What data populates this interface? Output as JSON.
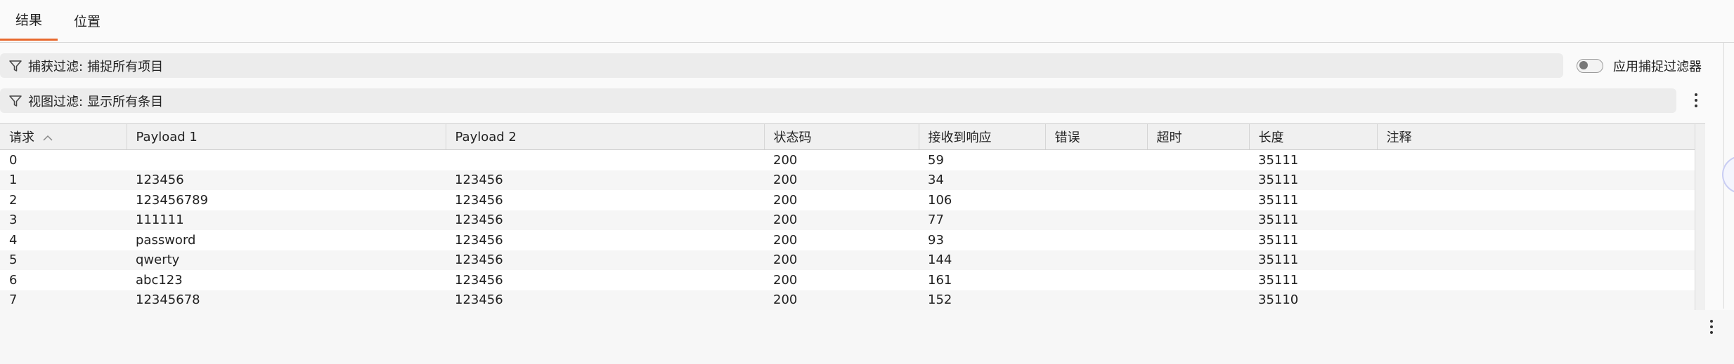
{
  "tabs": [
    {
      "label": "结果",
      "active": true
    },
    {
      "label": "位置",
      "active": false
    }
  ],
  "capture_filter": {
    "label": "捕获过滤:",
    "value": "捕捉所有项目"
  },
  "view_filter": {
    "label": "视图过滤:",
    "value": "显示所有条目"
  },
  "apply_capture_filter": {
    "label": "应用捕捉过滤器",
    "enabled": false
  },
  "table": {
    "columns": [
      "请求",
      "Payload 1",
      "Payload 2",
      "状态码",
      "接收到响应",
      "错误",
      "超时",
      "长度",
      "注释"
    ],
    "sorted_column": "请求",
    "rows": [
      [
        "0",
        "",
        "",
        "200",
        "59",
        "",
        "",
        "35111",
        ""
      ],
      [
        "1",
        "123456",
        "123456",
        "200",
        "34",
        "",
        "",
        "35111",
        ""
      ],
      [
        "2",
        "123456789",
        "123456",
        "200",
        "106",
        "",
        "",
        "35111",
        ""
      ],
      [
        "3",
        "111111",
        "123456",
        "200",
        "77",
        "",
        "",
        "35111",
        ""
      ],
      [
        "4",
        "password",
        "123456",
        "200",
        "93",
        "",
        "",
        "35111",
        ""
      ],
      [
        "5",
        "qwerty",
        "123456",
        "200",
        "144",
        "",
        "",
        "35111",
        ""
      ],
      [
        "6",
        "abc123",
        "123456",
        "200",
        "161",
        "",
        "",
        "35111",
        ""
      ],
      [
        "7",
        "12345678",
        "123456",
        "200",
        "152",
        "",
        "",
        "35110",
        ""
      ]
    ]
  },
  "icons": {
    "filter": "filter-funnel-icon",
    "more": "kebab-menu-icon",
    "sort": "sort-ascending-icon"
  },
  "colors": {
    "active_tab_underline": "#e8692e"
  }
}
